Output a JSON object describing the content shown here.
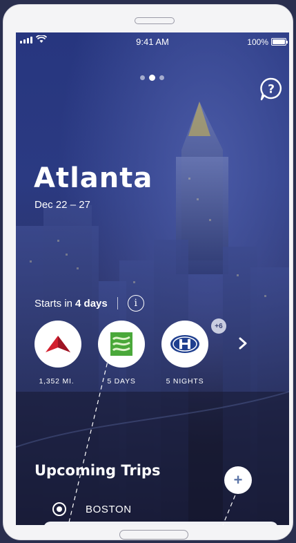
{
  "status_bar": {
    "time": "9:41 AM",
    "battery_percent": "100%"
  },
  "pager": {
    "count": 3,
    "active_index": 1
  },
  "header": {
    "help_icon": "question-bubble-icon"
  },
  "trip": {
    "city": "Atlanta",
    "dates": "Dec 22 – 27",
    "starts_in_prefix": "Starts in",
    "starts_in_value": "4 days",
    "info_icon_glyph": "i"
  },
  "summary_items": [
    {
      "icon": "airline-logo-icon",
      "label": "1,352 MI."
    },
    {
      "icon": "car-rental-logo-icon",
      "label": "5 DAYS"
    },
    {
      "icon": "hotel-logo-icon",
      "label": "5 NIGHTS"
    }
  ],
  "more_badge": "+6",
  "upcoming": {
    "title": "Upcoming Trips",
    "add_label": "+",
    "trips": [
      {
        "city": "BOSTON",
        "selected": true
      }
    ]
  },
  "colors": {
    "airline_red": "#d3202f",
    "car_green": "#4aa83a",
    "hotel_blue": "#1f3f8f"
  }
}
